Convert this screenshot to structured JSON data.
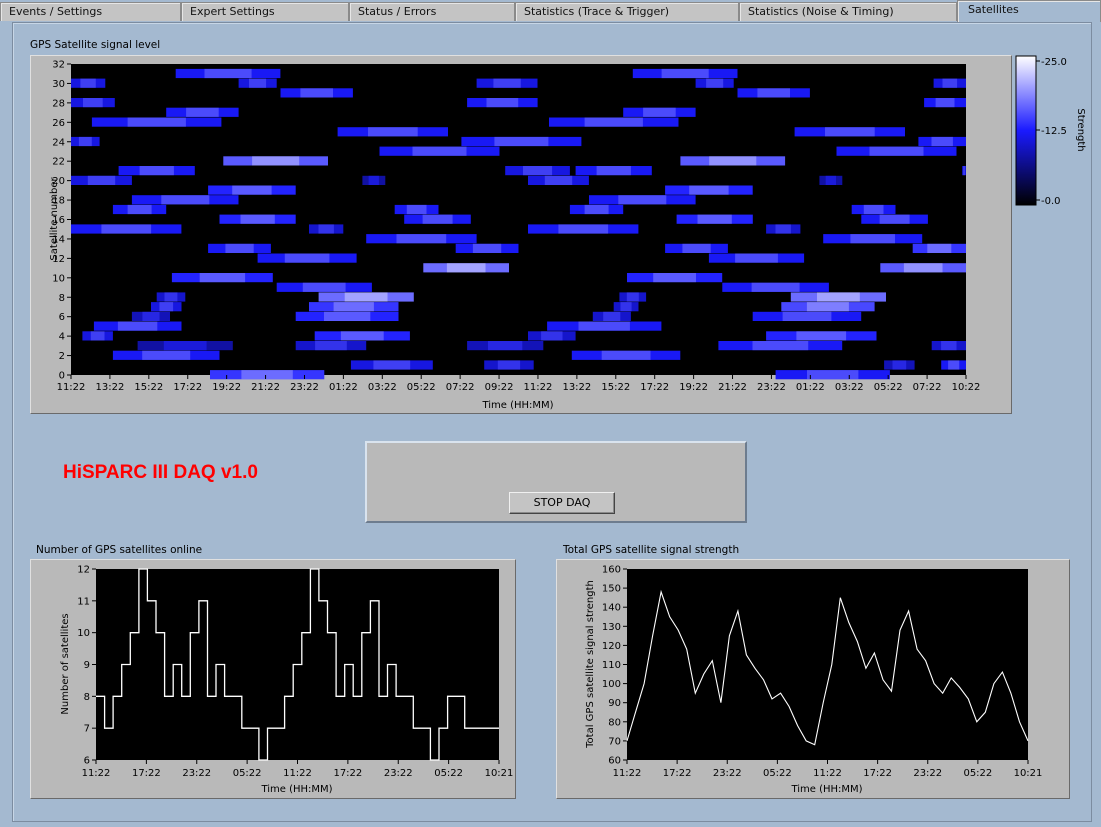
{
  "tabs": [
    {
      "label": "Events / Settings",
      "active": false
    },
    {
      "label": "Expert Settings",
      "active": false
    },
    {
      "label": "Status / Errors",
      "active": false
    },
    {
      "label": "Statistics (Trace & Trigger)",
      "active": false
    },
    {
      "label": "Statistics (Noise & Timing)",
      "active": false
    },
    {
      "label": "Satellites",
      "active": true
    }
  ],
  "app_title": "HiSPARC III  DAQ v1.0",
  "stop_button_label": "STOP DAQ",
  "colors": {
    "background": "#a4b9d0",
    "plot_background": "#000000",
    "trace": "#ffffff",
    "app_title": "#ff0000",
    "heatmap_low": "#000000",
    "heatmap_mid": "#1a1aff",
    "heatmap_high": "#ffffff"
  },
  "heatmap": {
    "caption": "GPS Satellite signal level",
    "xlabel": "Time (HH:MM)",
    "ylabel": "Satellite number",
    "x_ticks": [
      "11:22",
      "13:22",
      "15:22",
      "17:22",
      "19:22",
      "21:22",
      "23:22",
      "01:22",
      "03:22",
      "05:22",
      "07:22",
      "09:22",
      "11:22",
      "13:22",
      "15:22",
      "17:22",
      "19:22",
      "21:22",
      "23:22",
      "01:22",
      "03:22",
      "05:22",
      "07:22",
      "10:22"
    ],
    "y_ticks": [
      "0",
      "2",
      "4",
      "6",
      "8",
      "10",
      "12",
      "14",
      "16",
      "18",
      "20",
      "22",
      "24",
      "26",
      "28",
      "30",
      "32"
    ],
    "colorbar_label": "Strength",
    "colorbar_ticks": [
      "-25.0",
      "-12.5",
      "-0.0"
    ]
  },
  "chart_data": [
    {
      "type": "heatmap",
      "title": "GPS Satellite signal level",
      "xlabel": "Time (HH:MM)",
      "ylabel": "Satellite number",
      "ylim": [
        0,
        32
      ],
      "zlim": [
        0,
        25
      ],
      "z_label": "Strength",
      "note_hours_span": [
        0,
        47
      ],
      "visibility_segments": [
        {
          "sat": 0,
          "start": 7.3,
          "end": 13.3,
          "level": 14
        },
        {
          "sat": 0,
          "start": 37,
          "end": 43,
          "level": 12
        },
        {
          "sat": 1,
          "start": 14.7,
          "end": 19,
          "level": 11
        },
        {
          "sat": 1,
          "start": 21.7,
          "end": 24.3,
          "level": 10
        },
        {
          "sat": 1,
          "start": 42.7,
          "end": 44.3,
          "level": 9
        },
        {
          "sat": 1,
          "start": 45.7,
          "end": 47,
          "level": 12
        },
        {
          "sat": 2,
          "start": 2.2,
          "end": 7.8,
          "level": 12
        },
        {
          "sat": 2,
          "start": 26.3,
          "end": 32,
          "level": 12
        },
        {
          "sat": 3,
          "start": 3.5,
          "end": 8.5,
          "level": 8
        },
        {
          "sat": 3,
          "start": 11.8,
          "end": 15.5,
          "level": 10
        },
        {
          "sat": 3,
          "start": 20.8,
          "end": 24.8,
          "level": 9
        },
        {
          "sat": 3,
          "start": 34,
          "end": 40.5,
          "level": 12
        },
        {
          "sat": 3,
          "start": 45.2,
          "end": 47,
          "level": 10
        },
        {
          "sat": 4,
          "start": 0.6,
          "end": 2.2,
          "level": 11
        },
        {
          "sat": 4,
          "start": 12.8,
          "end": 17.8,
          "level": 13
        },
        {
          "sat": 4,
          "start": 24,
          "end": 26.5,
          "level": 10
        },
        {
          "sat": 4,
          "start": 36.5,
          "end": 42.3,
          "level": 13
        },
        {
          "sat": 5,
          "start": 1.2,
          "end": 5.8,
          "level": 12
        },
        {
          "sat": 5,
          "start": 25,
          "end": 31,
          "level": 12
        },
        {
          "sat": 6,
          "start": 3.2,
          "end": 5.2,
          "level": 9
        },
        {
          "sat": 6,
          "start": 11.8,
          "end": 17.2,
          "level": 13
        },
        {
          "sat": 6,
          "start": 27.4,
          "end": 29.4,
          "level": 10
        },
        {
          "sat": 6,
          "start": 35.8,
          "end": 41.5,
          "level": 12
        },
        {
          "sat": 7,
          "start": 4.2,
          "end": 5.8,
          "level": 11
        },
        {
          "sat": 7,
          "start": 12.5,
          "end": 17.2,
          "level": 14
        },
        {
          "sat": 7,
          "start": 28.5,
          "end": 29.8,
          "level": 10
        },
        {
          "sat": 7,
          "start": 37.3,
          "end": 42.2,
          "level": 15
        },
        {
          "sat": 8,
          "start": 4.5,
          "end": 6,
          "level": 10
        },
        {
          "sat": 8,
          "start": 13,
          "end": 18,
          "level": 17
        },
        {
          "sat": 8,
          "start": 28.8,
          "end": 30.2,
          "level": 10
        },
        {
          "sat": 8,
          "start": 37.8,
          "end": 42.8,
          "level": 17
        },
        {
          "sat": 9,
          "start": 10.8,
          "end": 15.8,
          "level": 12
        },
        {
          "sat": 9,
          "start": 34.2,
          "end": 39.8,
          "level": 12
        },
        {
          "sat": 10,
          "start": 5.3,
          "end": 10.6,
          "level": 13
        },
        {
          "sat": 10,
          "start": 29.2,
          "end": 34.2,
          "level": 13
        },
        {
          "sat": 11,
          "start": 18.5,
          "end": 23,
          "level": 17
        },
        {
          "sat": 11,
          "start": 42.5,
          "end": 47,
          "level": 16
        },
        {
          "sat": 12,
          "start": 9.8,
          "end": 15,
          "level": 12
        },
        {
          "sat": 12,
          "start": 33.5,
          "end": 38.5,
          "level": 12
        },
        {
          "sat": 13,
          "start": 7.2,
          "end": 10.5,
          "level": 12
        },
        {
          "sat": 13,
          "start": 20.2,
          "end": 23.5,
          "level": 12
        },
        {
          "sat": 13,
          "start": 31.2,
          "end": 34.5,
          "level": 12
        },
        {
          "sat": 13,
          "start": 44.2,
          "end": 47,
          "level": 14
        },
        {
          "sat": 14,
          "start": 15.5,
          "end": 21.3,
          "level": 12
        },
        {
          "sat": 14,
          "start": 39.5,
          "end": 44.7,
          "level": 12
        },
        {
          "sat": 15,
          "start": 0,
          "end": 5.8,
          "level": 12
        },
        {
          "sat": 15,
          "start": 12.5,
          "end": 14.3,
          "level": 10
        },
        {
          "sat": 15,
          "start": 24,
          "end": 29.8,
          "level": 12
        },
        {
          "sat": 15,
          "start": 36.5,
          "end": 38.3,
          "level": 10
        },
        {
          "sat": 16,
          "start": 7.8,
          "end": 11.8,
          "level": 13
        },
        {
          "sat": 16,
          "start": 17.5,
          "end": 21,
          "level": 12
        },
        {
          "sat": 16,
          "start": 31.8,
          "end": 35.8,
          "level": 13
        },
        {
          "sat": 16,
          "start": 41.5,
          "end": 45,
          "level": 12
        },
        {
          "sat": 17,
          "start": 2.2,
          "end": 5,
          "level": 12
        },
        {
          "sat": 17,
          "start": 17,
          "end": 19.3,
          "level": 12
        },
        {
          "sat": 17,
          "start": 26.2,
          "end": 29,
          "level": 12
        },
        {
          "sat": 17,
          "start": 41,
          "end": 43.3,
          "level": 12
        },
        {
          "sat": 18,
          "start": 3.2,
          "end": 8.8,
          "level": 12
        },
        {
          "sat": 18,
          "start": 27.2,
          "end": 32.8,
          "level": 12
        },
        {
          "sat": 19,
          "start": 7.2,
          "end": 11.8,
          "level": 13
        },
        {
          "sat": 19,
          "start": 31.2,
          "end": 35.8,
          "level": 13
        },
        {
          "sat": 20,
          "start": 0,
          "end": 3.2,
          "level": 11
        },
        {
          "sat": 20,
          "start": 15.3,
          "end": 16.5,
          "level": 8
        },
        {
          "sat": 20,
          "start": 24,
          "end": 27.2,
          "level": 11
        },
        {
          "sat": 20,
          "start": 39.3,
          "end": 40.5,
          "level": 8
        },
        {
          "sat": 21,
          "start": 2.5,
          "end": 6.5,
          "level": 12
        },
        {
          "sat": 21,
          "start": 22.8,
          "end": 26.2,
          "level": 11
        },
        {
          "sat": 21,
          "start": 26.5,
          "end": 30.5,
          "level": 12
        },
        {
          "sat": 21,
          "start": 46.8,
          "end": 47,
          "level": 11
        },
        {
          "sat": 22,
          "start": 8,
          "end": 13.5,
          "level": 16
        },
        {
          "sat": 22,
          "start": 32,
          "end": 37.5,
          "level": 16
        },
        {
          "sat": 23,
          "start": 16.2,
          "end": 22.5,
          "level": 12
        },
        {
          "sat": 23,
          "start": 40.2,
          "end": 46.5,
          "level": 12
        },
        {
          "sat": 24,
          "start": 0,
          "end": 1.5,
          "level": 11
        },
        {
          "sat": 24,
          "start": 20.5,
          "end": 26.8,
          "level": 12
        },
        {
          "sat": 24,
          "start": 44.5,
          "end": 47,
          "level": 12
        },
        {
          "sat": 25,
          "start": 14,
          "end": 19.8,
          "level": 12
        },
        {
          "sat": 25,
          "start": 38,
          "end": 43.8,
          "level": 12
        },
        {
          "sat": 26,
          "start": 1.1,
          "end": 7.9,
          "level": 12
        },
        {
          "sat": 26,
          "start": 25.1,
          "end": 31.9,
          "level": 12
        },
        {
          "sat": 27,
          "start": 5,
          "end": 8.8,
          "level": 12
        },
        {
          "sat": 27,
          "start": 29,
          "end": 32.8,
          "level": 12
        },
        {
          "sat": 28,
          "start": 0,
          "end": 2.3,
          "level": 11
        },
        {
          "sat": 28,
          "start": 20.8,
          "end": 24.5,
          "level": 12
        },
        {
          "sat": 28,
          "start": 44.8,
          "end": 47,
          "level": 12
        },
        {
          "sat": 29,
          "start": 11,
          "end": 14.8,
          "level": 12
        },
        {
          "sat": 29,
          "start": 35,
          "end": 38.8,
          "level": 12
        },
        {
          "sat": 30,
          "start": 0,
          "end": 1.8,
          "level": 11
        },
        {
          "sat": 30,
          "start": 8.8,
          "end": 10.8,
          "level": 11
        },
        {
          "sat": 30,
          "start": 21.3,
          "end": 24.5,
          "level": 11
        },
        {
          "sat": 30,
          "start": 32.8,
          "end": 34.8,
          "level": 11
        },
        {
          "sat": 30,
          "start": 45.3,
          "end": 47,
          "level": 11
        },
        {
          "sat": 31,
          "start": 5.5,
          "end": 11,
          "level": 12
        },
        {
          "sat": 31,
          "start": 29.5,
          "end": 35,
          "level": 12
        }
      ]
    },
    {
      "type": "line",
      "title": "Number of GPS satellites online",
      "xlabel": "Time (HH:MM)",
      "ylabel": "Number of satellites",
      "ylim": [
        6,
        12
      ],
      "x_ticks": [
        "11:22",
        "17:22",
        "23:22",
        "05:22",
        "11:22",
        "17:22",
        "23:22",
        "05:22",
        "10:21"
      ],
      "y_ticks": [
        6,
        7,
        8,
        9,
        10,
        11,
        12
      ],
      "x_hours": [
        0,
        1,
        2,
        3,
        4,
        5,
        6,
        7,
        8,
        9,
        10,
        11,
        12,
        13,
        14,
        15,
        16,
        17,
        18,
        19,
        20,
        21,
        22,
        23,
        24,
        25,
        26,
        27,
        28,
        29,
        30,
        31,
        32,
        33,
        34,
        35,
        36,
        37,
        38,
        39,
        40,
        41,
        42,
        43,
        44,
        45,
        46,
        47
      ],
      "values": [
        8,
        7,
        8,
        9,
        10,
        12,
        11,
        10,
        8,
        9,
        8,
        10,
        11,
        8,
        9,
        8,
        8,
        7,
        7,
        6,
        7,
        7,
        8,
        9,
        10,
        12,
        11,
        10,
        8,
        9,
        8,
        10,
        11,
        8,
        9,
        8,
        8,
        7,
        7,
        6,
        7,
        8,
        8,
        7,
        7,
        7,
        7,
        7
      ]
    },
    {
      "type": "line",
      "title": "Total GPS satellite signal strength",
      "xlabel": "Time (HH:MM)",
      "ylabel": "Total GPS satellite signal strength",
      "ylim": [
        60,
        160
      ],
      "x_ticks": [
        "11:22",
        "17:22",
        "23:22",
        "05:22",
        "11:22",
        "17:22",
        "23:22",
        "05:22",
        "10:21"
      ],
      "y_ticks": [
        60,
        70,
        80,
        90,
        100,
        110,
        120,
        130,
        140,
        150,
        160
      ],
      "x_hours": [
        0,
        1,
        2,
        3,
        4,
        5,
        6,
        7,
        8,
        9,
        10,
        11,
        12,
        13,
        14,
        15,
        16,
        17,
        18,
        19,
        20,
        21,
        22,
        23,
        24,
        25,
        26,
        27,
        28,
        29,
        30,
        31,
        32,
        33,
        34,
        35,
        36,
        37,
        38,
        39,
        40,
        41,
        42,
        43,
        44,
        45,
        46,
        47
      ],
      "values": [
        70,
        85,
        100,
        125,
        148,
        135,
        128,
        118,
        95,
        105,
        112,
        90,
        125,
        138,
        115,
        108,
        102,
        92,
        95,
        88,
        78,
        70,
        68,
        90,
        110,
        145,
        132,
        122,
        108,
        116,
        102,
        96,
        128,
        138,
        118,
        112,
        100,
        95,
        103,
        98,
        92,
        80,
        85,
        100,
        106,
        95,
        80,
        70
      ]
    }
  ],
  "bottom_left": {
    "caption": "Number of GPS satellites online",
    "xlabel": "Time (HH:MM)",
    "ylabel": "Number of satellites"
  },
  "bottom_right": {
    "caption": "Total GPS satellite signal strength",
    "xlabel": "Time (HH:MM)",
    "ylabel": "Total GPS satellite signal strength"
  }
}
